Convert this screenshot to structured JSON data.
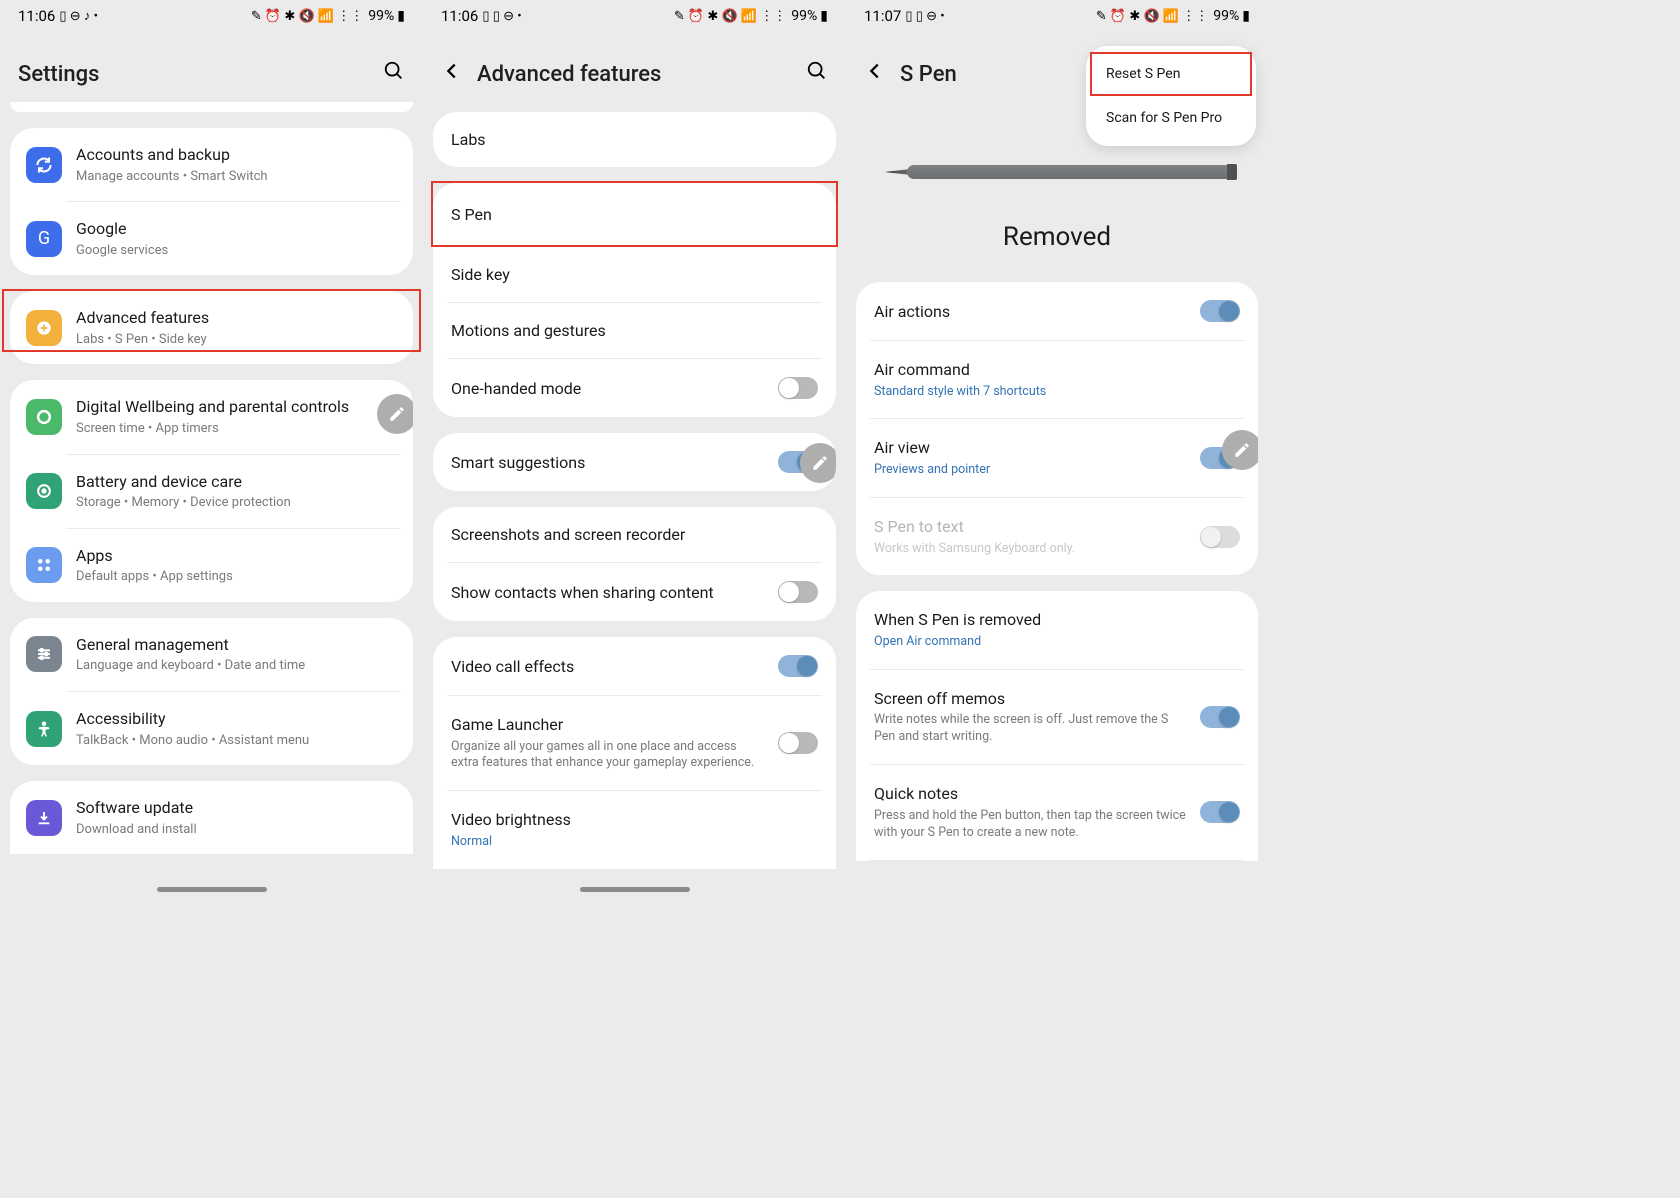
{
  "screen1": {
    "time": "11:06",
    "status_icons_left": "▯ ⊖ ♪ •",
    "status_icons_right": "✎ ⏰ ✱ 🔇 📶 ⋮⋮",
    "battery": "99%",
    "title": "Settings",
    "rows": {
      "accounts": {
        "title": "Accounts and backup",
        "sub": "Manage accounts  •  Smart Switch"
      },
      "google": {
        "title": "Google",
        "sub": "Google services"
      },
      "advanced": {
        "title": "Advanced features",
        "sub": "Labs  •  S Pen  •  Side key"
      },
      "wellbeing": {
        "title": "Digital Wellbeing and parental controls",
        "sub": "Screen time  •  App timers"
      },
      "battery": {
        "title": "Battery and device care",
        "sub": "Storage  •  Memory  •  Device protection"
      },
      "apps": {
        "title": "Apps",
        "sub": "Default apps  •  App settings"
      },
      "general": {
        "title": "General management",
        "sub": "Language and keyboard  •  Date and time"
      },
      "accessibility": {
        "title": "Accessibility",
        "sub": "TalkBack  •  Mono audio  •  Assistant menu"
      },
      "software": {
        "title": "Software update",
        "sub": "Download and install"
      }
    }
  },
  "screen2": {
    "time": "11:06",
    "status_icons_left": "▯ ▯ ⊖ •",
    "status_icons_right": "✎ ⏰ ✱ 🔇 📶 ⋮⋮",
    "battery": "99%",
    "title": "Advanced features",
    "rows": {
      "labs": "Labs",
      "spen": "S Pen",
      "sidekey": "Side key",
      "motions": "Motions and gestures",
      "onehanded": "One-handed mode",
      "smart": "Smart suggestions",
      "screenshots": "Screenshots and screen recorder",
      "contacts": "Show contacts when sharing content",
      "video": "Video call effects",
      "game": {
        "title": "Game Launcher",
        "sub": "Organize all your games all in one place and access extra features that enhance your gameplay experience."
      },
      "brightness": {
        "title": "Video brightness",
        "sub": "Normal"
      }
    }
  },
  "screen3": {
    "time": "11:07",
    "status_icons_left": "▯ ▯ ⊖ •",
    "status_icons_right": "✎ ⏰ ✱ 🔇 📶 ⋮⋮",
    "battery": "99%",
    "title": "S Pen",
    "menu": {
      "reset": "Reset S Pen",
      "scan": "Scan for S Pen Pro"
    },
    "status": "Removed",
    "rows": {
      "airactions": "Air actions",
      "aircommand": {
        "title": "Air command",
        "sub": "Standard style with 7 shortcuts"
      },
      "airview": {
        "title": "Air view",
        "sub": "Previews and pointer"
      },
      "spentotext": {
        "title": "S Pen to text",
        "sub": "Works with Samsung Keyboard only."
      },
      "removed": {
        "title": "When S Pen is removed",
        "sub": "Open Air command"
      },
      "screenoff": {
        "title": "Screen off memos",
        "sub": "Write notes while the screen is off. Just remove the S Pen and start writing."
      },
      "quicknotes": {
        "title": "Quick notes",
        "sub": "Press and hold the Pen button, then tap the screen twice with your S Pen to create a new note."
      }
    }
  }
}
